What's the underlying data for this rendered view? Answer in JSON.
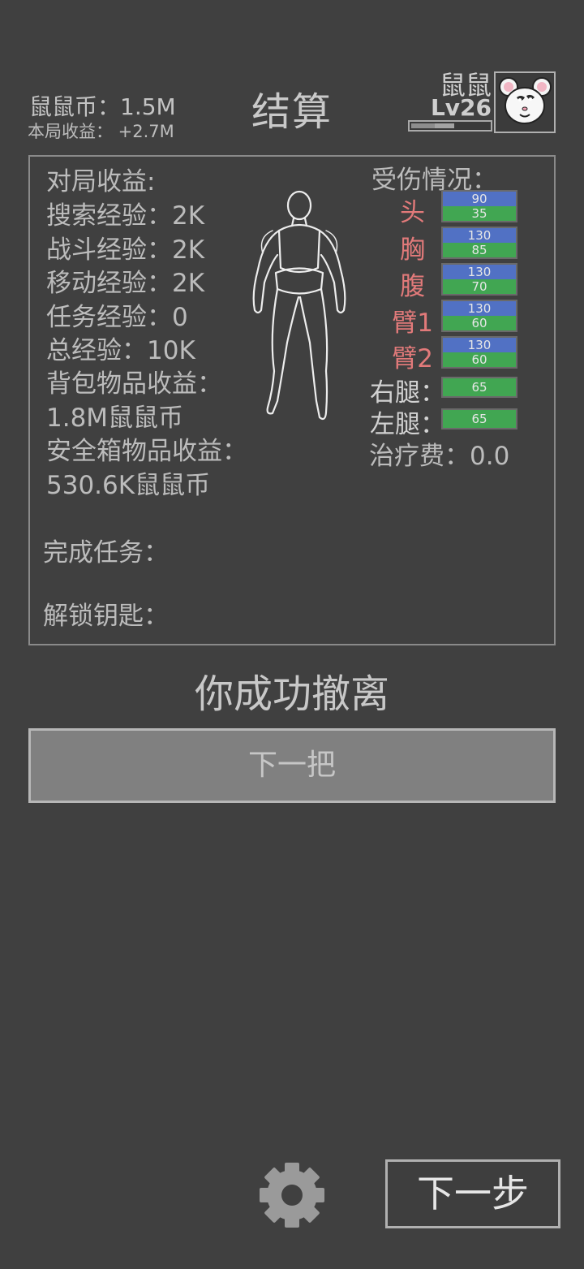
{
  "header": {
    "coins_label": "鼠鼠币：1.5M",
    "round_income_label": "本局收益：  +2.7M",
    "title": "结算",
    "player_name": "鼠鼠",
    "player_level": "Lv26",
    "xp_progress": 0.55
  },
  "summary": {
    "section_title": "对局收益:",
    "search_exp": "搜索经验：2K",
    "combat_exp": "战斗经验：2K",
    "move_exp": "移动经验：2K",
    "task_exp": "任务经验：0",
    "total_exp": "总经验：10K",
    "backpack_label": "背包物品收益：",
    "backpack_value": "1.8M鼠鼠币",
    "safebox_label": "安全箱物品收益：",
    "safebox_value": "530.6K鼠鼠币",
    "tasks_label": "完成任务：",
    "keys_label": "解锁钥匙："
  },
  "injury": {
    "title": "受伤情况：",
    "parts": [
      {
        "label": "头",
        "max": "90",
        "current": "35"
      },
      {
        "label": "胸",
        "max": "130",
        "current": "85"
      },
      {
        "label": "腹",
        "max": "130",
        "current": "70"
      },
      {
        "label": "臂1",
        "max": "130",
        "current": "60"
      },
      {
        "label": "臂2",
        "max": "130",
        "current": "60"
      },
      {
        "label": "右腿：",
        "current": "65"
      },
      {
        "label": "左腿：",
        "current": "65"
      }
    ],
    "fee": "治疗费：0.0"
  },
  "result_text": "你成功撤离",
  "buttons": {
    "next_round": "下一把",
    "next_step": "下一步"
  },
  "colors": {
    "background": "#404040",
    "hp_max": "#5171c4",
    "hp_current": "#41a652",
    "injured_label": "#e27a7a"
  }
}
